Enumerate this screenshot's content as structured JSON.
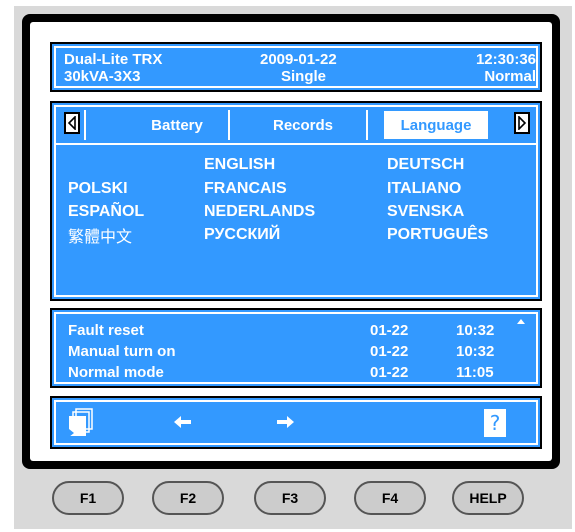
{
  "status": {
    "model": "Dual-Lite TRX",
    "rating": "30kVA-3X3",
    "date": "2009-01-22",
    "mode_type": "Single",
    "time": "12:30:36",
    "state": "Normal"
  },
  "tabs": {
    "items": [
      {
        "label": "Battery",
        "active": false
      },
      {
        "label": "Records",
        "active": false
      },
      {
        "label": "Language",
        "active": true
      }
    ],
    "prev_icon": "triangle-left-icon",
    "next_icon": "triangle-right-icon"
  },
  "languages": {
    "english": "ENGLISH",
    "deutsch": "DEUTSCH",
    "polski": "POLSKI",
    "francais": "FRANCAIS",
    "italiano": "ITALIANO",
    "espanol": "ESPAÑOL",
    "nederlands": "NEDERLANDS",
    "svenska": "SVENSKA",
    "chinese": "繁體中文",
    "russian": "РУССКИЙ",
    "portugues": "PORTUGUÊS"
  },
  "log": {
    "entries": [
      {
        "event": "Fault reset",
        "date": "01-22",
        "time": "10:32"
      },
      {
        "event": "Manual turn on",
        "date": "01-22",
        "time": "10:32"
      },
      {
        "event": "Normal mode",
        "date": "01-22",
        "time": "11:05"
      }
    ],
    "scroll_icon": "scroll-up-icon"
  },
  "fkeys": {
    "f1_icon": "window-stack-icon",
    "f2_icon": "arrow-left-icon",
    "f3_icon": "arrow-right-icon",
    "help_icon": "question-mark-icon",
    "help_glyph": "?"
  },
  "hardware_buttons": {
    "f1": "F1",
    "f2": "F2",
    "f3": "F3",
    "f4": "F4",
    "help": "HELP"
  },
  "colors": {
    "panel": "#3399ff",
    "bezel": "#000000",
    "device": "#d9d9d9"
  }
}
